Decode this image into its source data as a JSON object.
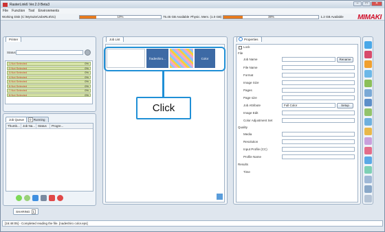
{
  "window": {
    "title": "RasterLink6 Ver.2.0 Beta3"
  },
  "menu": [
    "File",
    "Function",
    "Tool",
    "Environments"
  ],
  "status_strip": {
    "disk_label": "Working Disk (C:\\MySuite\\JobsRL6\\01)",
    "disk_pct_text": "10%",
    "disk_pct": 0.1,
    "disk_avail": "75.45 GB Available",
    "mem_label": "Physic. Mem. (1.0 GB)",
    "mem_pct_text": "38%",
    "mem_pct": 0.38,
    "mem_avail": "1.2 GB Available",
    "logo": "MIMAKI"
  },
  "left_panel": {
    "tab": "Printer",
    "status_label": "Status",
    "printers": [
      {
        "name": "1.Not Selected",
        "pct": "0%"
      },
      {
        "name": "2.Not Selected",
        "pct": "0%"
      },
      {
        "name": "3.Not Selected",
        "pct": "0%"
      },
      {
        "name": "4.Not Selected",
        "pct": "0%"
      },
      {
        "name": "5.Not Selected",
        "pct": "0%"
      },
      {
        "name": "6.Not Selected",
        "pct": "0%"
      },
      {
        "name": "7.Not Selected",
        "pct": "0%"
      },
      {
        "name": "8.Not Selected",
        "pct": "0%"
      }
    ],
    "queue_tabs": [
      "Job Queue",
      "Running"
    ],
    "queue_tab_count": "0",
    "columns": [
      "Thumb...",
      "Job Na...",
      "Status",
      "Progre..."
    ]
  },
  "job_list": {
    "tab": "Job List",
    "items": [
      {
        "name": "",
        "label": "fradeshiro..."
      },
      {
        "name": "",
        "label": "Color"
      }
    ]
  },
  "properties": {
    "tab": "Properties",
    "lock_label": "Lock",
    "sections": {
      "file": "File",
      "quality": "Quality",
      "results": "Results"
    },
    "fields": {
      "job_name": "Job Name",
      "file_name": "File Name",
      "format": "Format",
      "image_size": "Image Size",
      "pages": "Pages",
      "page_size": "Page size",
      "job_attribute": "Job Attribute",
      "job_attribute_value": "Full Color",
      "image_edit": "Image Edit",
      "color_adjust": "Color Adjustment Set",
      "media": "Media",
      "resolution": "Resolution",
      "input_profile": "Input Profile (CC)",
      "profile_name": "Profile Name",
      "time": "Time"
    },
    "rename_btn": "Rename",
    "setup_btn": "Setup"
  },
  "host_tab": "SHARING",
  "host_tab_count": "1",
  "bottom_status": "[16:48:05] - Completed reading the file. [nadeshiro color.eps]",
  "callout": {
    "text": "Click"
  }
}
